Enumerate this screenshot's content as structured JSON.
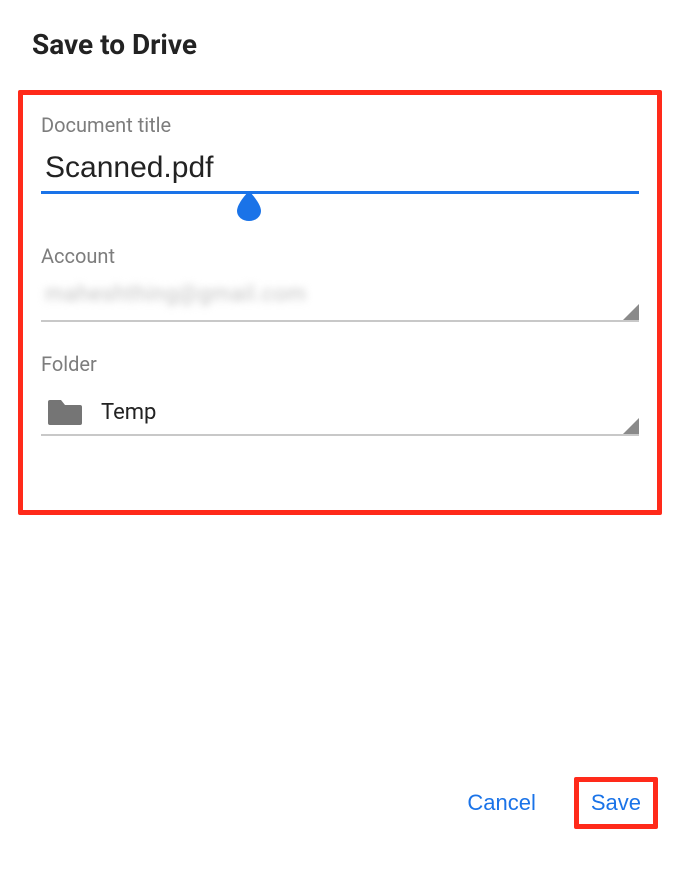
{
  "header": {
    "title": "Save to Drive"
  },
  "form": {
    "document_title": {
      "label": "Document title",
      "value": "Scanned.pdf"
    },
    "account": {
      "label": "Account",
      "value": "maheshthing@gmail.com"
    },
    "folder": {
      "label": "Folder",
      "value": "Temp"
    }
  },
  "actions": {
    "cancel": "Cancel",
    "save": "Save"
  },
  "colors": {
    "accent": "#1a73e8",
    "highlight": "#ff2a1a"
  }
}
